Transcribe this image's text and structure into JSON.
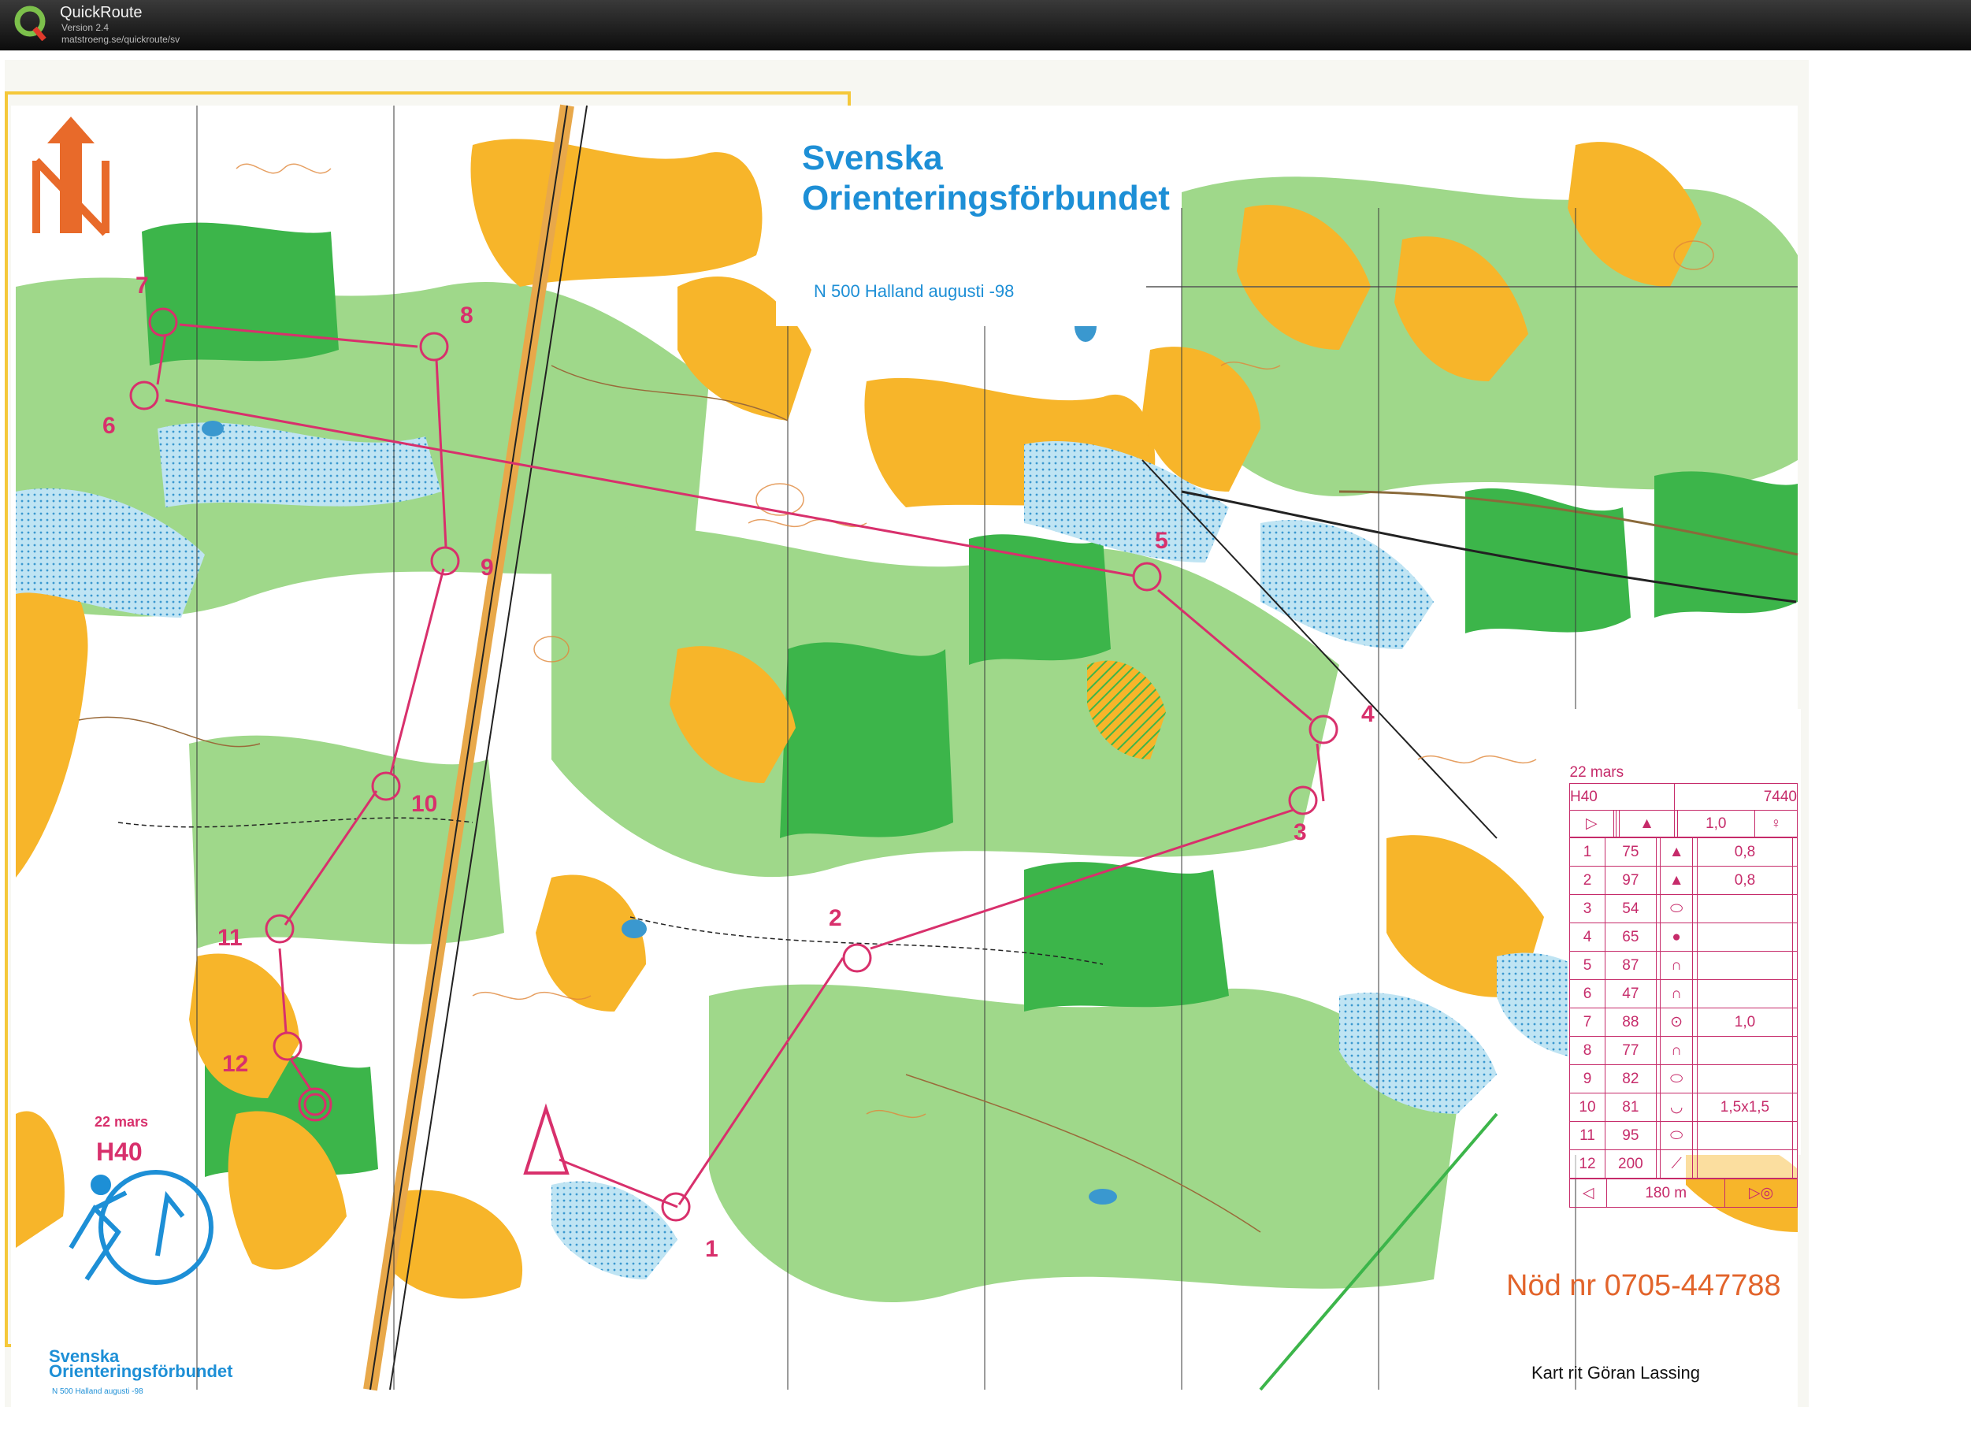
{
  "window": {
    "app_name": "QuickRoute",
    "version": "Version 2.4",
    "url": "matstroeng.se/quickroute/sv",
    "icon": "quickroute-q-icon"
  },
  "map_header": {
    "line1": "Svenska",
    "line2": "Orienteringsförbundet",
    "subtitle": "N 500 Halland   augusti -98"
  },
  "logo": {
    "line1": "Svenska",
    "line2": "Orienteringsförbundet",
    "subtitle": "N 500 Halland   augusti -98",
    "icon": "runner-compass-logo-icon"
  },
  "north_arrow": {
    "icon": "north-arrow-icon"
  },
  "course_label": {
    "date": "22 mars",
    "class": "H40"
  },
  "emergency": "Nöd nr 0705-447788",
  "cartographer": "Kart rit Göran Lassing",
  "controls": [
    {
      "number": "1"
    },
    {
      "number": "2"
    },
    {
      "number": "3"
    },
    {
      "number": "4"
    },
    {
      "number": "5"
    },
    {
      "number": "6"
    },
    {
      "number": "7"
    },
    {
      "number": "8"
    },
    {
      "number": "9"
    },
    {
      "number": "10"
    },
    {
      "number": "11"
    },
    {
      "number": "12"
    }
  ],
  "description_sheet": {
    "date": "22 mars",
    "class": "H40",
    "length": "7440",
    "start_dist": "1,0",
    "rows": [
      {
        "n": "1",
        "code": "75",
        "dim": "0,8"
      },
      {
        "n": "2",
        "code": "97",
        "dim": "0,8"
      },
      {
        "n": "3",
        "code": "54",
        "dim": ""
      },
      {
        "n": "4",
        "code": "65",
        "dim": ""
      },
      {
        "n": "5",
        "code": "87",
        "dim": ""
      },
      {
        "n": "6",
        "code": "47",
        "dim": ""
      },
      {
        "n": "7",
        "code": "88",
        "dim": "1,0"
      },
      {
        "n": "8",
        "code": "77",
        "dim": ""
      },
      {
        "n": "9",
        "code": "82",
        "dim": ""
      },
      {
        "n": "10",
        "code": "81",
        "dim": "1,5x1,5"
      },
      {
        "n": "11",
        "code": "95",
        "dim": ""
      },
      {
        "n": "12",
        "code": "200",
        "dim": ""
      }
    ],
    "finish_dist": "180 m"
  },
  "colors": {
    "course": "#d8306c",
    "forest_green": "#3cb54a",
    "light_green": "#9fd88a",
    "open_yellow": "#f7b52a",
    "water_blue": "#4aa8d8",
    "header_blue": "#1d8fd6"
  }
}
